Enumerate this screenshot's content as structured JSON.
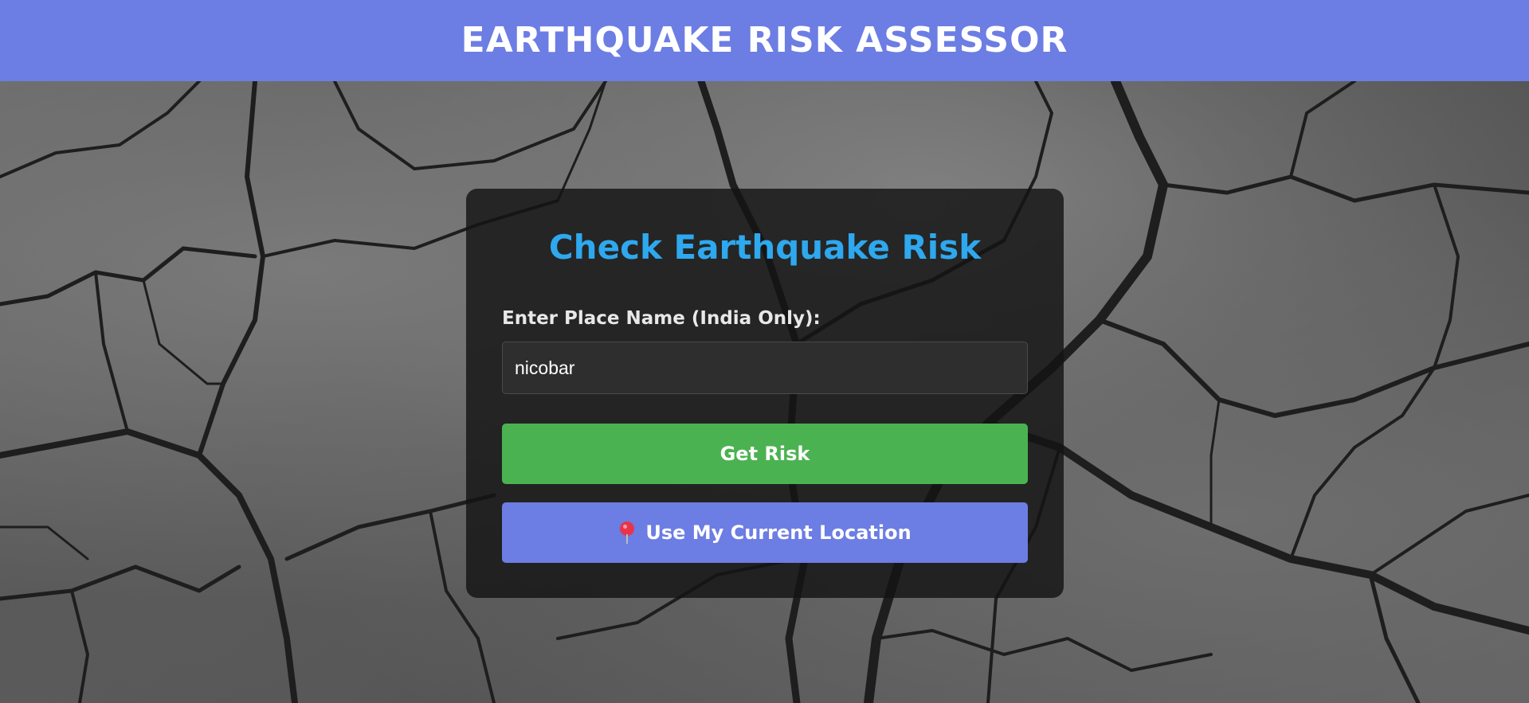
{
  "header": {
    "title": "EARTHQUAKE RISK ASSESSOR"
  },
  "card": {
    "title": "Check Earthquake Risk",
    "place_label": "Enter Place Name (India Only):",
    "place_value": "nicobar",
    "get_risk_label": "Get Risk",
    "location_label": "Use My Current Location",
    "location_icon": "pin-icon"
  },
  "colors": {
    "header_bg": "#6c7de3",
    "title_accent": "#2ea8ee",
    "get_risk_button": "#4bb251",
    "location_button": "#6c7de3",
    "card_bg": "#141414"
  }
}
